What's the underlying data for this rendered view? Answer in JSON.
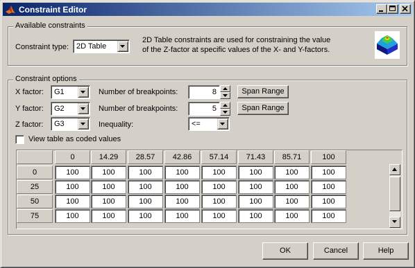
{
  "window": {
    "title": "Constraint Editor",
    "title_icon": "matlab-logo-icon",
    "controls": [
      "minimize-icon",
      "maximize-icon",
      "close-icon"
    ]
  },
  "available_constraints": {
    "group_label": "Available constraints",
    "type_label": "Constraint type:",
    "type_value": "2D Table",
    "description_line1": "2D Table constraints are used for constraining the value",
    "description_line2": "of the Z-factor at specific values of the X- and Y-factors.",
    "thumbnail_icon": "surface-plot-icon"
  },
  "constraint_options": {
    "group_label": "Constraint options",
    "x_factor_label": "X factor:",
    "x_factor_value": "G1",
    "y_factor_label": "Y factor:",
    "y_factor_value": "G2",
    "z_factor_label": "Z factor:",
    "z_factor_value": "G3",
    "x_breakpoints_label": "Number of breakpoints:",
    "x_breakpoints_value": "8",
    "y_breakpoints_label": "Number of breakpoints:",
    "y_breakpoints_value": "5",
    "span_range_x": "Span Range",
    "span_range_y": "Span Range",
    "inequality_label": "Inequality:",
    "inequality_value": "<=",
    "coded_values_label": "View table as coded values",
    "coded_values_checked": false
  },
  "table": {
    "column_headers": [
      "0",
      "14.29",
      "28.57",
      "42.86",
      "57.14",
      "71.43",
      "85.71",
      "100"
    ],
    "rows": [
      {
        "header": "0",
        "cells": [
          "100",
          "100",
          "100",
          "100",
          "100",
          "100",
          "100",
          "100"
        ]
      },
      {
        "header": "25",
        "cells": [
          "100",
          "100",
          "100",
          "100",
          "100",
          "100",
          "100",
          "100"
        ]
      },
      {
        "header": "50",
        "cells": [
          "100",
          "100",
          "100",
          "100",
          "100",
          "100",
          "100",
          "100"
        ]
      },
      {
        "header": "75",
        "cells": [
          "100",
          "100",
          "100",
          "100",
          "100",
          "100",
          "100",
          "100"
        ]
      }
    ]
  },
  "footer": {
    "ok": "OK",
    "cancel": "Cancel",
    "help": "Help"
  }
}
